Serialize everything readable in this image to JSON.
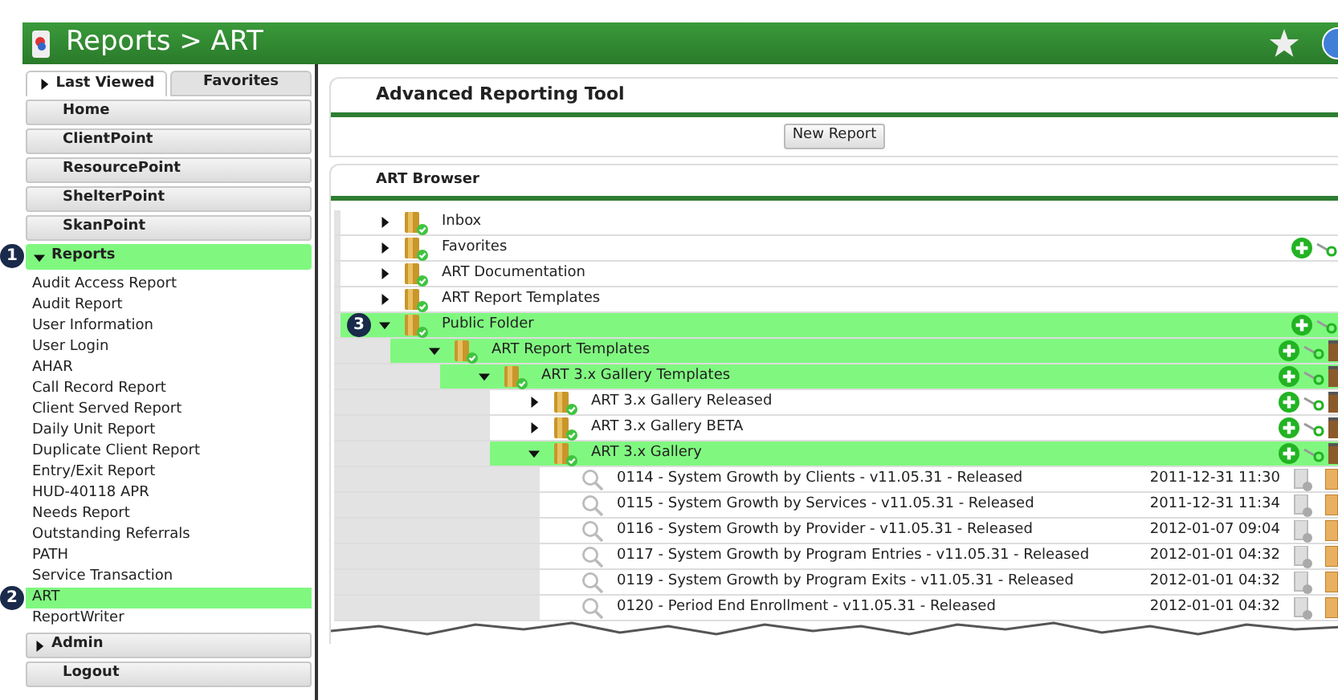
{
  "title": "Reports > ART",
  "sidebar": {
    "tabs": [
      {
        "label": "Last Viewed",
        "selected": true
      },
      {
        "label": "Favorites",
        "selected": false
      }
    ],
    "sections": [
      {
        "label": "Home",
        "kind": "link"
      },
      {
        "label": "ClientPoint",
        "kind": "link"
      },
      {
        "label": "ResourcePoint",
        "kind": "link"
      },
      {
        "label": "ShelterPoint",
        "kind": "link"
      },
      {
        "label": "SkanPoint",
        "kind": "link"
      },
      {
        "label": "Reports",
        "kind": "group",
        "expanded": true,
        "callout": "1",
        "items": [
          {
            "label": "Audit Access Report",
            "selected": false
          },
          {
            "label": "Audit Report",
            "selected": false
          },
          {
            "label": "User Information",
            "selected": false
          },
          {
            "label": "User Login",
            "selected": false
          },
          {
            "label": "AHAR",
            "selected": false
          },
          {
            "label": "Call Record Report",
            "selected": false
          },
          {
            "label": "Client Served Report",
            "selected": false
          },
          {
            "label": "Daily Unit Report",
            "selected": false
          },
          {
            "label": "Duplicate Client Report",
            "selected": false
          },
          {
            "label": "Entry/Exit Report",
            "selected": false
          },
          {
            "label": "HUD-40118 APR",
            "selected": false
          },
          {
            "label": "Needs Report",
            "selected": false
          },
          {
            "label": "Outstanding Referrals",
            "selected": false
          },
          {
            "label": "PATH",
            "selected": false
          },
          {
            "label": "Service Transaction",
            "selected": false
          },
          {
            "label": "ART",
            "selected": true,
            "callout": "2"
          },
          {
            "label": "ReportWriter",
            "selected": false
          }
        ]
      },
      {
        "label": "Admin",
        "kind": "group",
        "expanded": false
      },
      {
        "label": "Logout",
        "kind": "link"
      }
    ]
  },
  "main": {
    "heading": "Advanced Reporting Tool",
    "new_report_button": "New Report",
    "browser_title": "ART Browser",
    "tree": [
      {
        "kind": "folder",
        "label": "Inbox",
        "expanded": false,
        "selected": false,
        "add_button": false,
        "trash_button": false
      },
      {
        "kind": "folder",
        "label": "Favorites",
        "expanded": false,
        "selected": false,
        "add_button": true,
        "trash_button": false
      },
      {
        "kind": "folder",
        "label": "ART Documentation",
        "expanded": false,
        "selected": false,
        "add_button": false,
        "trash_button": false
      },
      {
        "kind": "folder",
        "label": "ART Report Templates",
        "expanded": false,
        "selected": false,
        "add_button": false,
        "trash_button": false
      },
      {
        "kind": "folder",
        "label": "Public Folder",
        "expanded": true,
        "selected": true,
        "add_button": true,
        "trash_button": false,
        "callout": "3",
        "children": [
          {
            "kind": "folder",
            "label": "ART Report Templates",
            "expanded": true,
            "selected": true,
            "add_button": true,
            "trash_button": true,
            "children": [
              {
                "kind": "folder",
                "label": "ART 3.x Gallery Templates",
                "expanded": true,
                "selected": true,
                "add_button": true,
                "trash_button": true,
                "children": [
                  {
                    "kind": "folder",
                    "label": "ART 3.x Gallery Released",
                    "expanded": false,
                    "selected": false,
                    "add_button": true,
                    "trash_button": true
                  },
                  {
                    "kind": "folder",
                    "label": "ART 3.x Gallery BETA",
                    "expanded": false,
                    "selected": false,
                    "add_button": true,
                    "trash_button": true
                  },
                  {
                    "kind": "folder",
                    "label": "ART 3.x Gallery",
                    "expanded": true,
                    "selected": true,
                    "add_button": true,
                    "trash_button": true,
                    "children": [
                      {
                        "kind": "report",
                        "label": "0114 - System Growth by Clients - v11.05.31 - Released",
                        "date": "2011-12-31 11:30"
                      },
                      {
                        "kind": "report",
                        "label": "0115 - System Growth by Services - v11.05.31 - Released",
                        "date": "2011-12-31 11:34"
                      },
                      {
                        "kind": "report",
                        "label": "0116 - System Growth by Provider - v11.05.31 - Released",
                        "date": "2012-01-07 09:04"
                      },
                      {
                        "kind": "report",
                        "label": "0117 - System Growth by Program Entries - v11.05.31 - Released",
                        "date": "2012-01-01 04:32"
                      },
                      {
                        "kind": "report",
                        "label": "0119 - System Growth by Program Exits - v11.05.31 - Released",
                        "date": "2012-01-01 04:32"
                      },
                      {
                        "kind": "report",
                        "label": "0120 - Period End Enrollment - v11.05.31 - Released",
                        "date": "2012-01-01 04:32"
                      }
                    ]
                  }
                ]
              }
            ]
          }
        ]
      }
    ]
  }
}
